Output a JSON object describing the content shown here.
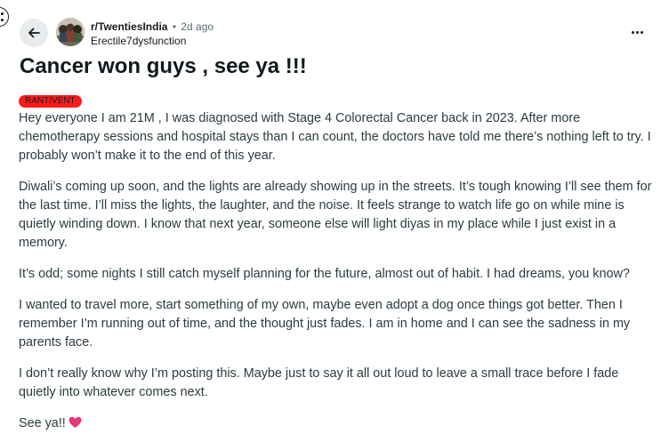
{
  "post": {
    "subreddit": "r/TwentiesIndia",
    "separator": "•",
    "time_ago": "2d ago",
    "author": "Erectile7dysfunction",
    "title": "Cancer won guys , see ya !!!",
    "flair": "RANT/VENT",
    "paragraphs": [
      "Hey everyone I am 21M , I was diagnosed with Stage 4 Colorectal Cancer back in 2023. After more chemotherapy sessions and hospital stays than I can count, the doctors have told me there’s nothing left to try. I probably won’t make it to the end of this year.",
      "Diwali’s coming up soon, and the lights are already showing up in the streets. It’s tough knowing I’ll see them for the last time. I’ll miss the lights, the laughter, and the noise. It feels strange to watch life go on while mine is quietly winding down. I know that next year, someone else will light diyas in my place while I just exist in a memory.",
      "It’s odd; some nights I still catch myself planning for the future, almost out of habit. I had dreams, you know?",
      "I wanted to travel more, start something of my own, maybe even adopt a dog once things got better. Then I remember I’m running out of time, and the thought just fades. I am in home and I can see the sadness in my parents face.",
      "I don’t really know why I’m posting this. Maybe just to say it all out loud to leave a small trace before I fade quietly into whatever comes next.",
      "See ya!!"
    ]
  },
  "icons": {
    "back": "back-arrow-icon",
    "more": "more-options-icon",
    "heart": "heart-icon",
    "edge": "scroll-menu-icon"
  },
  "colors": {
    "flair_bg": "#ff1a1a",
    "heart": "#e8357f",
    "back_button_bg": "#e9ecee",
    "meta_text": "#576f76"
  }
}
